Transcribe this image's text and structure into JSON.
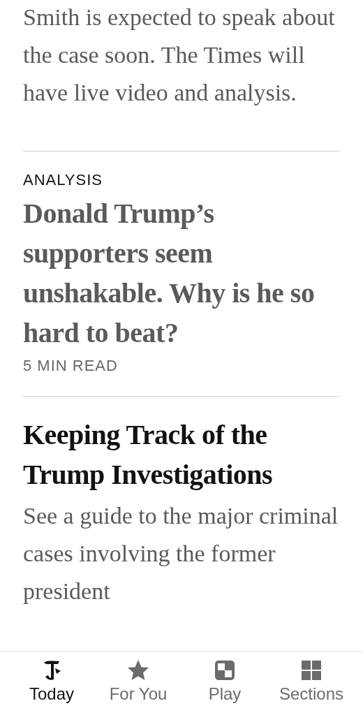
{
  "articles": [
    {
      "summary": "Smith is expected to speak about the case soon. The Times will have live video and analysis.",
      "read": false
    },
    {
      "kicker": "ANALYSIS",
      "headline": "Donald Trump’s supporters seem unshakable. Why is he so hard to beat?",
      "read": true,
      "meta": "5 MIN READ"
    },
    {
      "headline": "Keeping Track of the Trump Investigations",
      "read": false,
      "summary": "See a guide to the major criminal cases involving the former president"
    }
  ],
  "tab_bar": [
    {
      "kind": "logo",
      "label": "Today",
      "selected": true
    },
    {
      "kind": "star",
      "label": "For You",
      "selected": false
    },
    {
      "kind": "puzzle",
      "label": "Play",
      "selected": false
    },
    {
      "kind": "grid",
      "label": "Sections",
      "selected": false
    }
  ]
}
